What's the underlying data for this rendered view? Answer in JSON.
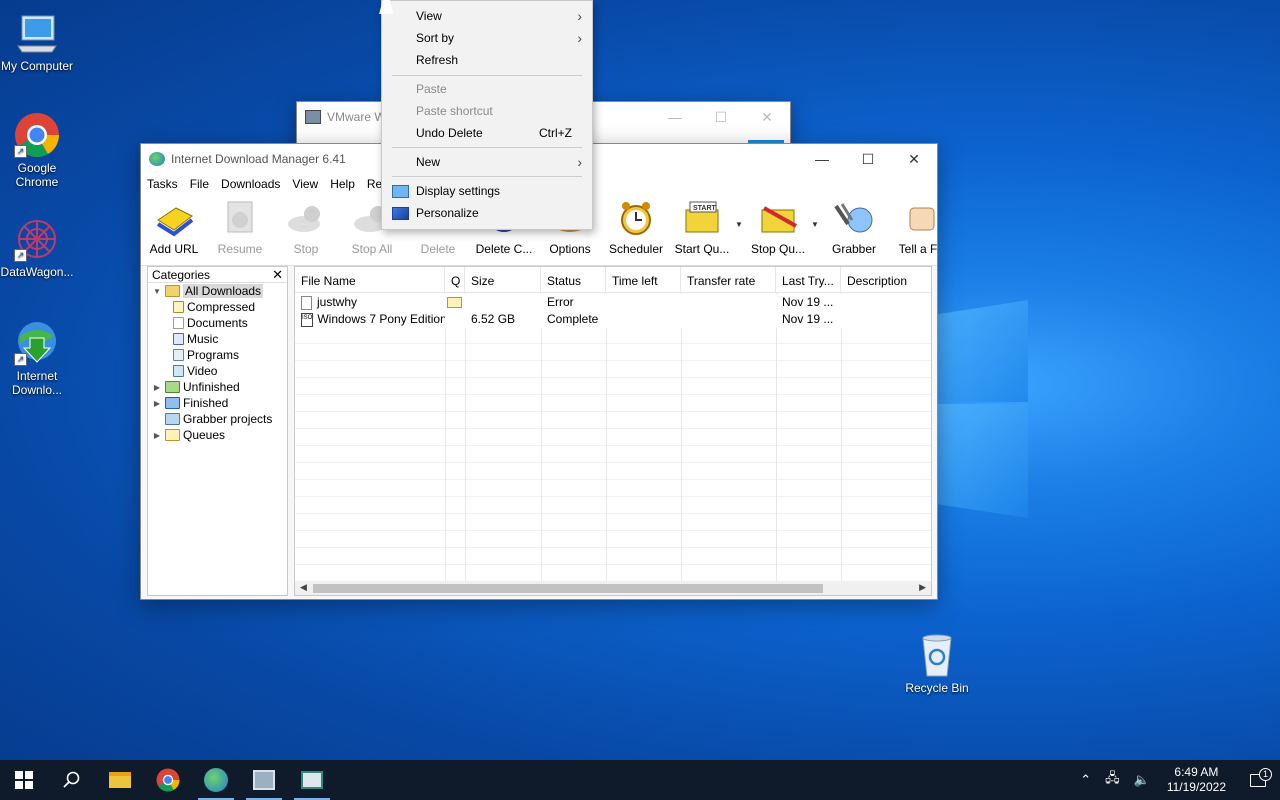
{
  "desktop": {
    "icons": [
      {
        "label": "My Computer",
        "icon": "computer-icon"
      },
      {
        "label": "Google Chrome",
        "icon": "chrome-icon"
      },
      {
        "label": "DataWagon...",
        "icon": "datawagon-icon"
      },
      {
        "label": "Internet Downlo...",
        "icon": "idm-icon"
      },
      {
        "label": "Recycle Bin",
        "icon": "recycle-bin-icon"
      }
    ]
  },
  "vmware_window": {
    "title": "VMware W"
  },
  "idm": {
    "title": "Internet Download Manager 6.41",
    "menu": [
      "Tasks",
      "File",
      "Downloads",
      "View",
      "Help",
      "Re"
    ],
    "toolbar": [
      {
        "label": "Add URL",
        "enabled": true
      },
      {
        "label": "Resume",
        "enabled": false
      },
      {
        "label": "Stop",
        "enabled": false
      },
      {
        "label": "Stop All",
        "enabled": false
      },
      {
        "label": "Delete",
        "enabled": false
      },
      {
        "label": "Delete C...",
        "enabled": true
      },
      {
        "label": "Options",
        "enabled": true
      },
      {
        "label": "Scheduler",
        "enabled": true
      },
      {
        "label": "Start Qu...",
        "enabled": true
      },
      {
        "label": "Stop Qu...",
        "enabled": true
      },
      {
        "label": "Grabber",
        "enabled": true
      },
      {
        "label": "Tell a Fr",
        "enabled": true
      }
    ],
    "categories": {
      "header": "Categories",
      "items": [
        {
          "label": "All Downloads",
          "level": 0,
          "selected": true
        },
        {
          "label": "Compressed",
          "level": 1
        },
        {
          "label": "Documents",
          "level": 1
        },
        {
          "label": "Music",
          "level": 1
        },
        {
          "label": "Programs",
          "level": 1
        },
        {
          "label": "Video",
          "level": 1
        },
        {
          "label": "Unfinished",
          "level": 0
        },
        {
          "label": "Finished",
          "level": 0
        },
        {
          "label": "Grabber projects",
          "level": 0
        },
        {
          "label": "Queues",
          "level": 0
        }
      ]
    },
    "columns": [
      "File Name",
      "Q",
      "Size",
      "Status",
      "Time left",
      "Transfer rate",
      "Last Try...",
      "Description"
    ],
    "rows": [
      {
        "name": "justwhy",
        "size": "",
        "status": "Error",
        "time_left": "",
        "rate": "",
        "last_try": "Nov 19 ...",
        "description": ""
      },
      {
        "name": "Windows 7 Pony Edition...",
        "size": "6.52  GB",
        "status": "Complete",
        "time_left": "",
        "rate": "",
        "last_try": "Nov 19 ...",
        "description": ""
      }
    ]
  },
  "context_menu": {
    "view": "View",
    "sort_by": "Sort by",
    "refresh": "Refresh",
    "paste": "Paste",
    "paste_shortcut": "Paste shortcut",
    "undo_delete": "Undo Delete",
    "undo_shortcut": "Ctrl+Z",
    "new": "New",
    "display_settings": "Display settings",
    "personalize": "Personalize"
  },
  "taskbar": {
    "time": "6:49 AM",
    "date": "11/19/2022",
    "notification_count": "1"
  },
  "colors": {
    "accent": "#0c63cf",
    "taskbar": "#0f1a2b"
  }
}
